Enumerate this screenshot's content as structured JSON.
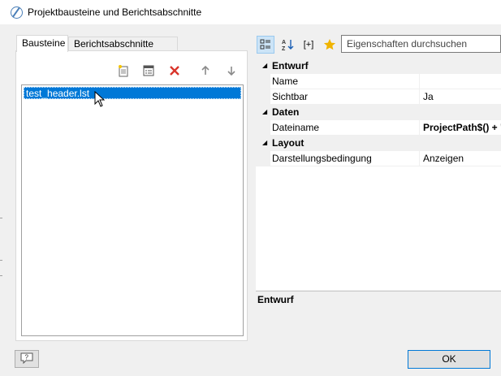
{
  "window": {
    "title": "Projektbausteine und Berichtsabschnitte"
  },
  "left": {
    "tabs": [
      {
        "label": "Bausteine",
        "active": true
      },
      {
        "label": "Berichtsabschnitte",
        "active": false
      }
    ],
    "toolbar": [
      "new-item-icon",
      "properties-icon",
      "delete-icon",
      "move-up-icon",
      "move-down-icon"
    ],
    "items": [
      {
        "label": "test_header.lst",
        "selected": true
      }
    ]
  },
  "right": {
    "toolbar": {
      "categorized_icon": "categorized-icon",
      "sort_icon": "sort-az-icon",
      "expand_label": "[+]",
      "favorites_icon": "star-icon"
    },
    "search": {
      "placeholder": "Eigenschaften durchsuchen"
    },
    "categories": [
      {
        "label": "Entwurf",
        "props": [
          {
            "name": "Name",
            "value": ""
          },
          {
            "name": "Sichtbar",
            "value": "Ja"
          }
        ]
      },
      {
        "label": "Daten",
        "props": [
          {
            "name": "Dateiname",
            "value": "ProjectPath$() + \""
          }
        ]
      },
      {
        "label": "Layout",
        "props": [
          {
            "name": "Darstellungsbedingung",
            "value": "Anzeigen"
          }
        ]
      }
    ],
    "description": {
      "title": "Entwurf"
    }
  },
  "buttons": {
    "ok": "OK",
    "help_icon": "help-icon"
  },
  "colors": {
    "selection": "#0078d7",
    "accent_star": "#f0b400",
    "delete_red": "#d9342b"
  }
}
